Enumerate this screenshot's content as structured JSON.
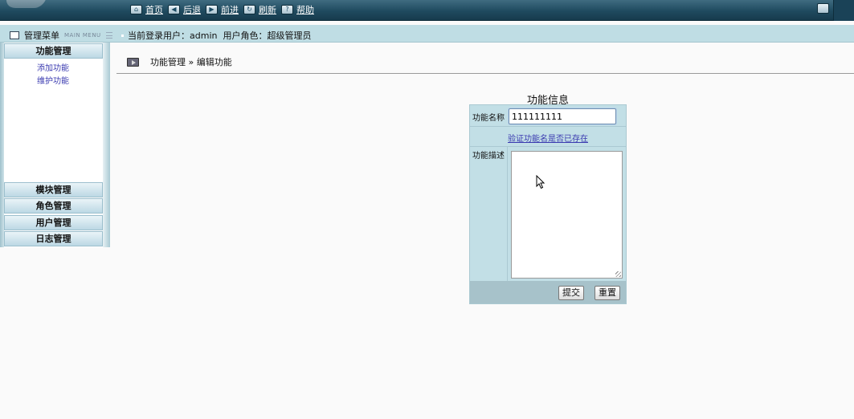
{
  "topbar": {
    "nav": [
      {
        "icon": "home-icon",
        "glyph": "⌂",
        "label": "首页"
      },
      {
        "icon": "back-icon",
        "glyph": "◀",
        "label": "后退"
      },
      {
        "icon": "forward-icon",
        "glyph": "▶",
        "label": "前进"
      },
      {
        "icon": "refresh-icon",
        "glyph": "↻",
        "label": "刷新"
      },
      {
        "icon": "help-icon",
        "glyph": "?",
        "label": "帮助"
      }
    ]
  },
  "infobar": {
    "menu_title": "管理菜单",
    "menu_title_en": "MAIN MENU",
    "user_info": "当前登录用户：admin  用户角色：超级管理员"
  },
  "sidebar": {
    "sections": [
      {
        "title": "功能管理",
        "links": [
          "添加功能",
          "维护功能"
        ]
      },
      {
        "title": "模块管理"
      },
      {
        "title": "角色管理"
      },
      {
        "title": "用户管理"
      },
      {
        "title": "日志管理"
      }
    ]
  },
  "breadcrumb": "功能管理 » 编辑功能",
  "form": {
    "title": "功能信息",
    "name_label": "功能名称",
    "name_value": "111111111",
    "verify_link": "验证功能名是否已存在",
    "desc_label": "功能描述",
    "desc_value": "",
    "submit_label": "提交",
    "reset_label": "重置"
  }
}
